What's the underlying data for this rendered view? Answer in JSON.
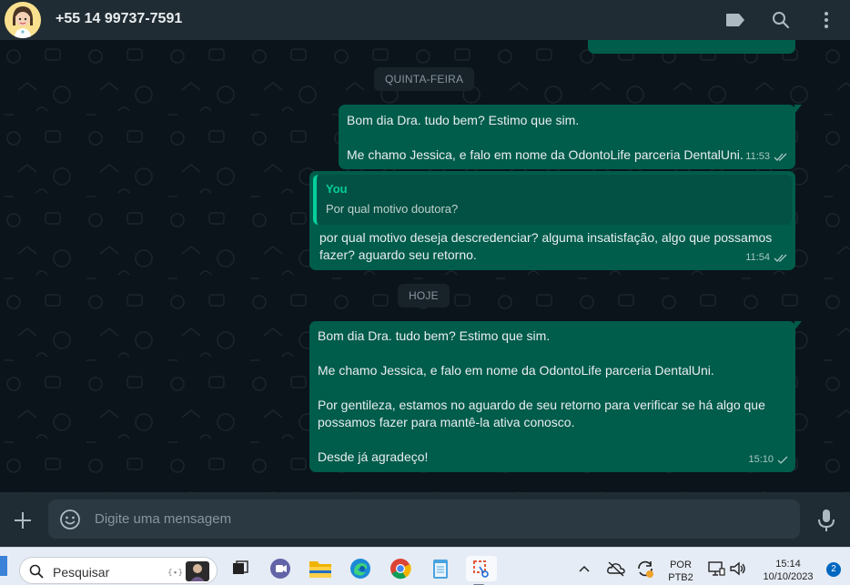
{
  "header": {
    "contact_name": "+55 14 99737-7591"
  },
  "chat": {
    "date_chips": [
      "QUINTA-FEIRA",
      "HOJE"
    ],
    "messages": [
      {
        "lines": [
          "Bom dia Dra. tudo bem? Estimo que sim.",
          "Me chamo Jessica, e falo em nome da OdontoLife parceria DentalUni."
        ],
        "time": "11:53",
        "status": "read"
      },
      {
        "quote_author": "You",
        "quote_text": "Por qual motivo doutora?",
        "lines": [
          "por qual motivo deseja descredenciar? alguma insatisfação, algo que possamos",
          "fazer? aguardo seu retorno."
        ],
        "time": "11:54",
        "status": "read"
      },
      {
        "lines": [
          "Bom dia Dra. tudo bem? Estimo que sim.",
          "Me chamo Jessica, e falo em nome da OdontoLife parceria DentalUni.",
          "Por gentileza, estamos no aguardo de seu retorno para verificar se há algo que",
          "possamos fazer para mantê-la ativa conosco.",
          "Desde já agradeço!"
        ],
        "time": "15:10",
        "status": "sent"
      }
    ]
  },
  "composer": {
    "placeholder": "Digite uma mensagem"
  },
  "taskbar": {
    "search_label": "Pesquisar",
    "lang_top": "POR",
    "lang_bottom": "PTB2",
    "clock_time": "15:14",
    "clock_date": "10/10/2023",
    "notification_count": "2"
  },
  "colors": {
    "outgoing_bubble": "#005c4b",
    "header": "#202c33",
    "chat_background": "#0b141a",
    "accent": "#06cf9c"
  }
}
